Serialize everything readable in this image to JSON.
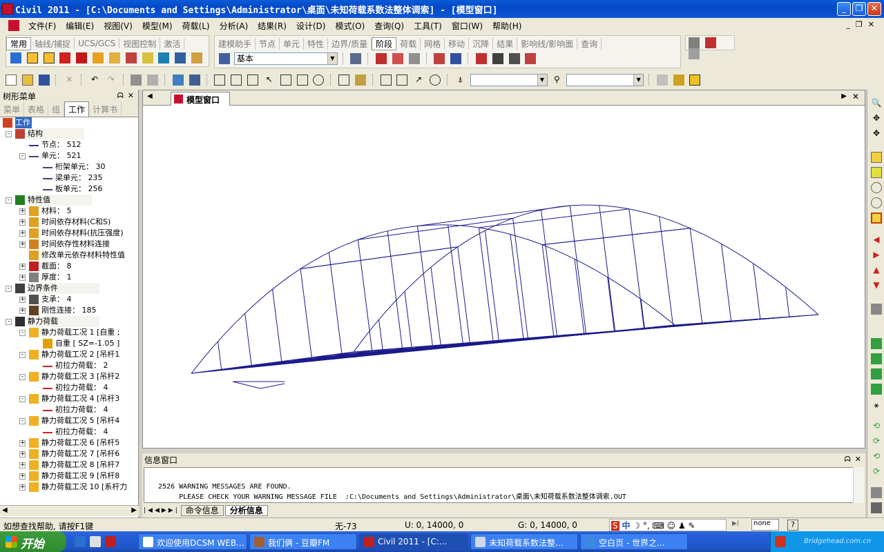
{
  "window": {
    "title": "Civil 2011 - [C:\\Documents and Settings\\Administrator\\桌面\\未知荷载系数法整体调索] - [模型窗口]"
  },
  "menu": [
    "文件(F)",
    "编辑(E)",
    "视图(V)",
    "模型(M)",
    "荷载(L)",
    "分析(A)",
    "结果(R)",
    "设计(D)",
    "模式(O)",
    "查询(Q)",
    "工具(T)",
    "窗口(W)",
    "帮助(H)"
  ],
  "toolbar": {
    "tabs_left": [
      "常用",
      "轴线/捕捉",
      "UCS/GCS",
      "视图控制",
      "激活"
    ],
    "tabs_right": [
      "建模助手",
      "节点",
      "单元",
      "特性",
      "边界/质量",
      "阶段",
      "荷载",
      "网格",
      "移动",
      "沉降",
      "结果",
      "影响线/影响面",
      "查询"
    ],
    "stage_combo": "基本"
  },
  "left_panel": {
    "title": "树形菜单",
    "tabs": [
      "菜单",
      "表格",
      "组",
      "工作",
      "计算书"
    ],
    "tree": [
      {
        "text": "工作",
        "level": 0,
        "icon": "work-icon",
        "expander": ""
      },
      {
        "text": "结构",
        "level": 1,
        "icon": "structure-icon",
        "expander": "-"
      },
      {
        "text": "节点： 512",
        "level": 2,
        "icon": "node-icon",
        "expander": ""
      },
      {
        "text": "单元： 521",
        "level": 2,
        "icon": "element-icon",
        "expander": "-"
      },
      {
        "text": "桁架单元： 30",
        "level": 3,
        "icon": "element-icon",
        "expander": ""
      },
      {
        "text": "梁单元： 235",
        "level": 3,
        "icon": "element-icon",
        "expander": ""
      },
      {
        "text": "板单元： 256",
        "level": 3,
        "icon": "element-icon",
        "expander": ""
      },
      {
        "text": "特性值",
        "level": 1,
        "icon": "property-icon",
        "expander": "-"
      },
      {
        "text": "材料： 5",
        "level": 2,
        "icon": "material-icon",
        "expander": "+"
      },
      {
        "text": "时间依存材料(C和S)",
        "level": 2,
        "icon": "material-icon",
        "expander": "+"
      },
      {
        "text": "时间依存材料(抗压强度)",
        "level": 2,
        "icon": "material-icon",
        "expander": "+"
      },
      {
        "text": "时间依存性材料连接",
        "level": 2,
        "icon": "material-link-icon",
        "expander": "+"
      },
      {
        "text": "修改单元依存材料特性值",
        "level": 2,
        "icon": "material-icon",
        "expander": ""
      },
      {
        "text": "截面： 8",
        "level": 2,
        "icon": "section-icon",
        "expander": "+"
      },
      {
        "text": "厚度： 1",
        "level": 2,
        "icon": "thickness-icon",
        "expander": "+"
      },
      {
        "text": "边界条件",
        "level": 1,
        "icon": "boundary-icon",
        "expander": "-"
      },
      {
        "text": "支承： 4",
        "level": 2,
        "icon": "support-icon",
        "expander": "+"
      },
      {
        "text": "刚性连接： 185",
        "level": 2,
        "icon": "rigid-link-icon",
        "expander": "+"
      },
      {
        "text": "静力荷载",
        "level": 1,
        "icon": "static-load-icon",
        "expander": "-"
      },
      {
        "text": "静力荷载工况 1 [自重 ;",
        "level": 2,
        "icon": "load-case-icon",
        "expander": "-"
      },
      {
        "text": "自重 [ SZ=-1.05 ]",
        "level": 3,
        "icon": "self-weight-icon",
        "expander": ""
      },
      {
        "text": "静力荷载工况 2 [吊杆1",
        "level": 2,
        "icon": "load-case-icon",
        "expander": "-"
      },
      {
        "text": "初拉力荷载： 2",
        "level": 3,
        "icon": "pretension-icon",
        "expander": ""
      },
      {
        "text": "静力荷载工况 3 [吊杆2",
        "level": 2,
        "icon": "load-case-icon",
        "expander": "-"
      },
      {
        "text": "初拉力荷载： 4",
        "level": 3,
        "icon": "pretension-icon",
        "expander": ""
      },
      {
        "text": "静力荷载工况 4 [吊杆3",
        "level": 2,
        "icon": "load-case-icon",
        "expander": "-"
      },
      {
        "text": "初拉力荷载： 4",
        "level": 3,
        "icon": "pretension-icon",
        "expander": ""
      },
      {
        "text": "静力荷载工况 5 [吊杆4",
        "level": 2,
        "icon": "load-case-icon",
        "expander": "-"
      },
      {
        "text": "初拉力荷载： 4",
        "level": 3,
        "icon": "pretension-icon",
        "expander": ""
      },
      {
        "text": "静力荷载工况 6 [吊杆5",
        "level": 2,
        "icon": "load-case-icon",
        "expander": "+"
      },
      {
        "text": "静力荷载工况 7 [吊杆6",
        "level": 2,
        "icon": "load-case-icon",
        "expander": "+"
      },
      {
        "text": "静力荷载工况 8 [吊杆7",
        "level": 2,
        "icon": "load-case-icon",
        "expander": "+"
      },
      {
        "text": "静力荷载工况 9 [吊杆8",
        "level": 2,
        "icon": "load-case-icon",
        "expander": "+"
      },
      {
        "text": "静力荷载工况 10 [系杆力",
        "level": 2,
        "icon": "load-case-icon",
        "expander": "+"
      }
    ]
  },
  "model_window": {
    "tab": "模型窗口"
  },
  "info_window": {
    "title": "信息窗口",
    "line1": "2526 WARNING MESSAGES ARE FOUND.",
    "line2": "     PLEASE CHECK YOUR WARNING MESSAGE FILE  :C:\\Documents and Settings\\Administrator\\桌面\\未知荷载系数法整体调索.OUT",
    "tabs": [
      "命令信息",
      "分析信息"
    ]
  },
  "status": {
    "help": "如想查找帮助, 请按F1键",
    "element": "无-73",
    "ucs": "U: 0, 14000, 0",
    "gcs": "G: 0, 14000, 0",
    "unit": "none"
  },
  "taskbar": {
    "start": "开始",
    "items": [
      "欢迎使用DCSM WEB...",
      "我们俩 - 豆瓣FM",
      "Civil 2011 - [C:...",
      "未知荷载系数法整...",
      "空白页 - 世界之..."
    ],
    "active_index": 2,
    "ime": "中"
  },
  "watermark": "Bridgehead.com.cn",
  "colors": {
    "accent": "#0548c4",
    "model_lines": "#1a1a8c",
    "taskbar": "#245edb"
  }
}
